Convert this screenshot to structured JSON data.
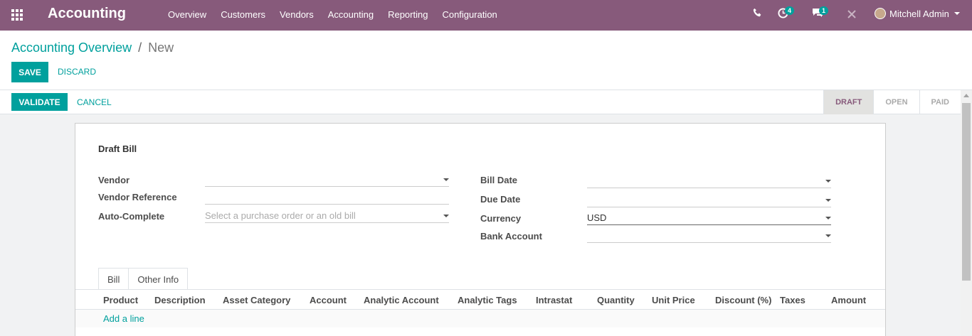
{
  "navbar": {
    "brand": "Accounting",
    "menu": [
      "Overview",
      "Customers",
      "Vendors",
      "Accounting",
      "Reporting",
      "Configuration"
    ],
    "activity_count": "4",
    "message_count": "1",
    "user": "Mitchell Admin",
    "bg_color": "#875a7b"
  },
  "breadcrumb": {
    "parent": "Accounting Overview",
    "separator": "/",
    "current": "New"
  },
  "actions": {
    "save": "SAVE",
    "discard": "DISCARD",
    "validate": "VALIDATE",
    "cancel": "CANCEL"
  },
  "status": {
    "steps": [
      "DRAFT",
      "OPEN",
      "PAID"
    ],
    "active": "DRAFT"
  },
  "form": {
    "title": "Draft Bill",
    "vendor_label": "Vendor",
    "vendor_ref_label": "Vendor Reference",
    "auto_complete_label": "Auto-Complete",
    "auto_complete_placeholder": "Select a purchase order or an old bill",
    "bill_date_label": "Bill Date",
    "due_date_label": "Due Date",
    "currency_label": "Currency",
    "currency_value": "USD",
    "bank_account_label": "Bank Account"
  },
  "tabs": [
    "Bill",
    "Other Info"
  ],
  "table": {
    "columns": [
      "Product",
      "Description",
      "Asset Category",
      "Account",
      "Analytic Account",
      "Analytic Tags",
      "Intrastat",
      "Quantity",
      "Unit Price",
      "Discount (%)",
      "Taxes",
      "Amount"
    ],
    "add_line": "Add a line"
  },
  "accent_color": "#00a09d"
}
